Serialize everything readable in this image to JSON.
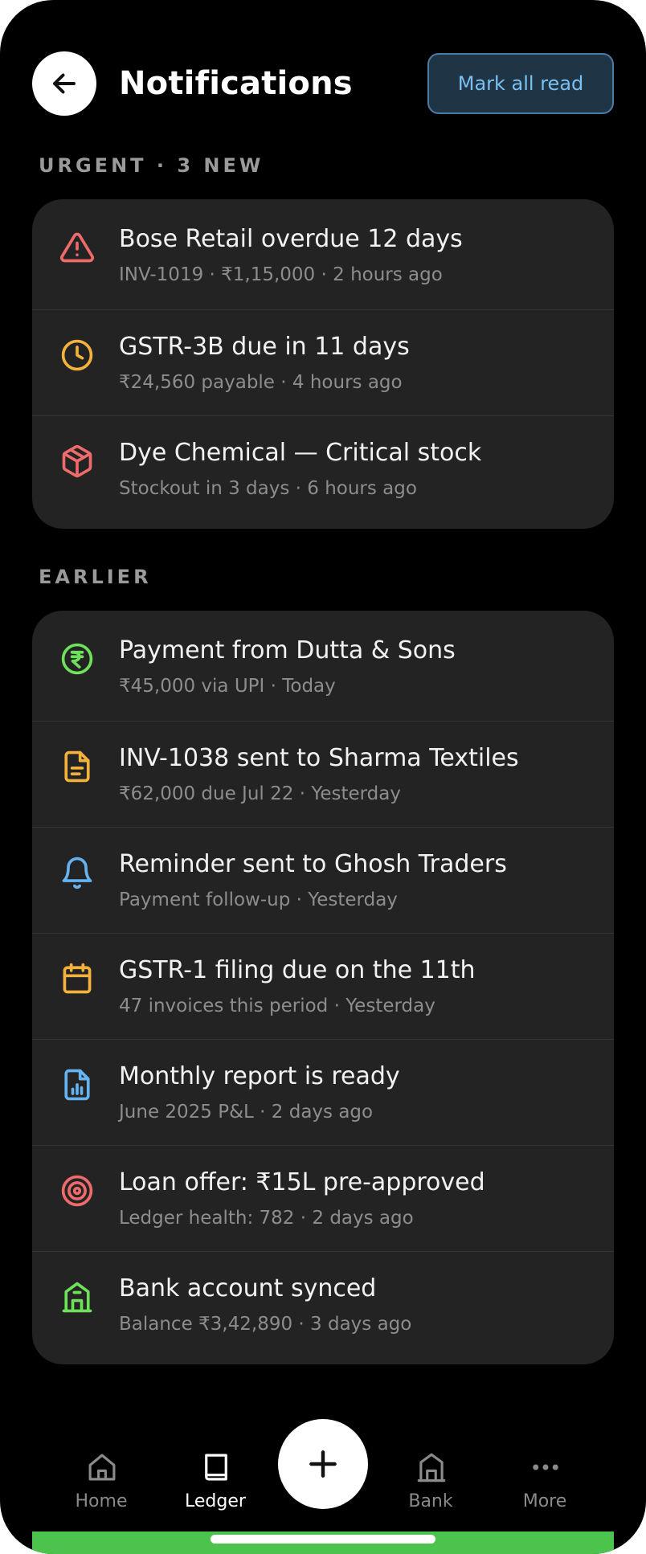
{
  "header": {
    "title": "Notifications",
    "mark_all_read": "Mark all read"
  },
  "urgent": {
    "label": "URGENT · 3 NEW",
    "items": [
      {
        "icon": "alert-triangle-icon",
        "color": "#ef6b6b",
        "title": "Bose Retail overdue 12 days",
        "sub": "INV-1019 · ₹1,15,000 · 2 hours ago"
      },
      {
        "icon": "clock-icon",
        "color": "#f3b23c",
        "title": "GSTR-3B due in 11 days",
        "sub": "₹24,560 payable · 4 hours ago"
      },
      {
        "icon": "package-icon",
        "color": "#ef6b6b",
        "title": "Dye Chemical — Critical stock",
        "sub": "Stockout in 3 days · 6 hours ago"
      }
    ]
  },
  "earlier": {
    "label": "EARLIER",
    "items": [
      {
        "icon": "rupee-icon",
        "color": "#6ee05a",
        "title": "Payment from Dutta & Sons",
        "sub": "₹45,000 via UPI · Today"
      },
      {
        "icon": "document-icon",
        "color": "#f3b23c",
        "title": "INV-1038 sent to Sharma Textiles",
        "sub": "₹62,000 due Jul 22 · Yesterday"
      },
      {
        "icon": "bell-icon",
        "color": "#66b3f2",
        "title": "Reminder sent to Ghosh Traders",
        "sub": "Payment follow-up · Yesterday"
      },
      {
        "icon": "calendar-icon",
        "color": "#f3b23c",
        "title": "GSTR-1 filing due on the 11th",
        "sub": "47 invoices this period · Yesterday"
      },
      {
        "icon": "report-icon",
        "color": "#66b3f2",
        "title": "Monthly report is ready",
        "sub": "June 2025 P&L · 2 days ago"
      },
      {
        "icon": "target-icon",
        "color": "#ef6b6b",
        "title": "Loan offer: ₹15L pre-approved",
        "sub": "Ledger health: 782 · 2 days ago"
      },
      {
        "icon": "bank-icon",
        "color": "#6ee05a",
        "title": "Bank account synced",
        "sub": "Balance ₹3,42,890 · 3 days ago"
      }
    ]
  },
  "tabbar": {
    "home": "Home",
    "ledger": "Ledger",
    "bank": "Bank",
    "more": "More",
    "active": "Ledger"
  }
}
